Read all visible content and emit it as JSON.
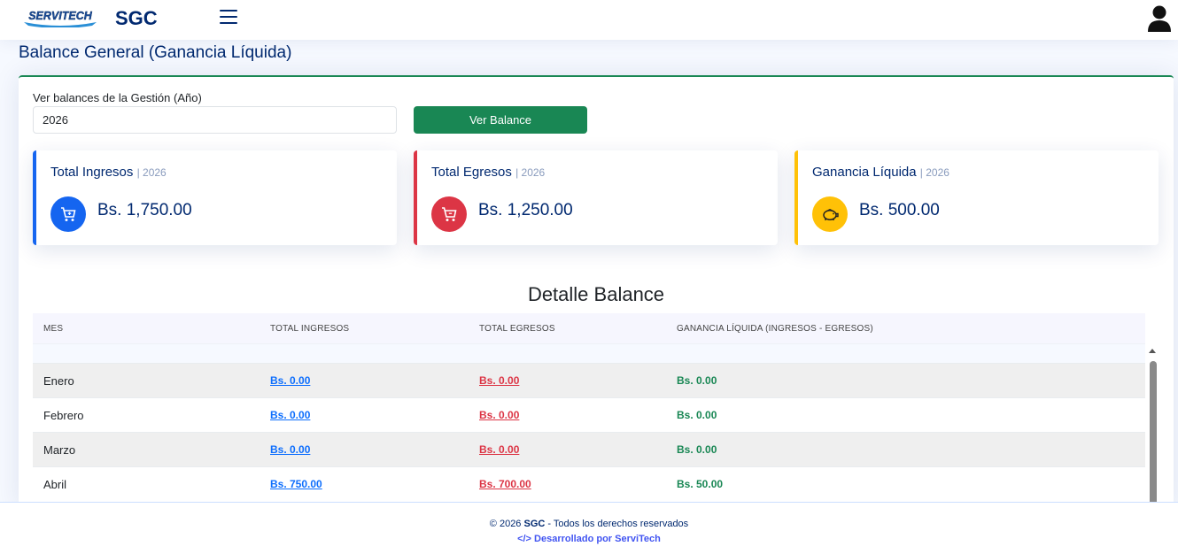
{
  "header": {
    "logo_text": "SERVITECH",
    "app_name": "SGC"
  },
  "page": {
    "title": "Balance General (Ganancia Líquida)"
  },
  "filter": {
    "label": "Ver balances de la Gestión (Año)",
    "year_value": "2026",
    "button_label": "Ver Balance"
  },
  "stats": [
    {
      "title": "Total Ingresos",
      "year": "| 2026",
      "value": "Bs. 1,750.00",
      "color": "#1565f0",
      "icon": "cart-icon"
    },
    {
      "title": "Total Egresos",
      "year": "| 2026",
      "value": "Bs. 1,250.00",
      "color": "#dc3545",
      "icon": "cart-icon"
    },
    {
      "title": "Ganancia Líquida",
      "year": "| 2026",
      "value": "Bs. 500.00",
      "color": "#ffc107",
      "icon": "piggy-bank-icon"
    }
  ],
  "detail": {
    "title": "Detalle Balance",
    "columns": [
      "MES",
      "TOTAL INGRESOS",
      "TOTAL EGRESOS",
      "GANANCIA LÍQUIDA (INGRESOS - EGRESOS)"
    ],
    "rows": [
      {
        "mes": "Enero",
        "ingresos": "Bs. 0.00",
        "egresos": "Bs. 0.00",
        "ganancia": "Bs. 0.00"
      },
      {
        "mes": "Febrero",
        "ingresos": "Bs. 0.00",
        "egresos": "Bs. 0.00",
        "ganancia": "Bs. 0.00"
      },
      {
        "mes": "Marzo",
        "ingresos": "Bs. 0.00",
        "egresos": "Bs. 0.00",
        "ganancia": "Bs. 0.00"
      },
      {
        "mes": "Abril",
        "ingresos": "Bs. 750.00",
        "egresos": "Bs. 700.00",
        "ganancia": "Bs. 50.00"
      }
    ]
  },
  "footer": {
    "copy_prefix": "© 2026",
    "copy_brand": "SGC",
    "copy_suffix": "- Todos los derechos reservados",
    "dev_icon": "code-icon",
    "dev_text": "Desarrollado por ServiTech"
  }
}
